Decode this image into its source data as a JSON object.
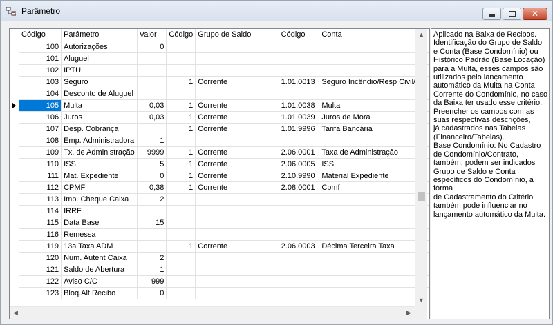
{
  "window": {
    "title": "Parâmetro",
    "close_glyph": "✕"
  },
  "icons": {
    "app": "database-icon",
    "minimize": "minimize-icon",
    "maximize": "maximize-icon",
    "close": "close-icon",
    "row_marker": "row-pointer-icon",
    "up": "arrow-up-icon",
    "down": "arrow-down-icon",
    "left": "arrow-left-icon",
    "right": "arrow-right-icon"
  },
  "grid": {
    "columns": [
      "Código",
      "Parâmetro",
      "Valor",
      "Código",
      "Grupo de Saldo",
      "Código",
      "Conta"
    ],
    "selected_code": "105",
    "vertical_scroll_position": 0.62,
    "rows": [
      [
        "100",
        "Autorizações",
        "0",
        "",
        "",
        "",
        ""
      ],
      [
        "101",
        "Aluguel",
        "",
        "",
        "",
        "",
        ""
      ],
      [
        "102",
        "IPTU",
        "",
        "",
        "",
        "",
        ""
      ],
      [
        "103",
        "Seguro",
        "",
        "1",
        "Corrente",
        "1.01.0013",
        "Seguro Incêndio/Resp Civil/Etc"
      ],
      [
        "104",
        "Desconto de Aluguel",
        "",
        "",
        "",
        "",
        ""
      ],
      [
        "105",
        "Multa",
        "0,03",
        "1",
        "Corrente",
        "1.01.0038",
        "Multa"
      ],
      [
        "106",
        "Juros",
        "0,03",
        "1",
        "Corrente",
        "1.01.0039",
        "Juros de Mora"
      ],
      [
        "107",
        "Desp. Cobrança",
        "",
        "1",
        "Corrente",
        "1.01.9996",
        "Tarifa Bancária"
      ],
      [
        "108",
        "Emp. Administradora",
        "1",
        "",
        "",
        "",
        ""
      ],
      [
        "109",
        "Tx. de Administração",
        "9999",
        "1",
        "Corrente",
        "2.06.0001",
        "Taxa de Administração"
      ],
      [
        "110",
        "ISS",
        "5",
        "1",
        "Corrente",
        "2.06.0005",
        "ISS"
      ],
      [
        "111",
        "Mat. Expediente",
        "0",
        "1",
        "Corrente",
        "2.10.9990",
        "Material Expediente"
      ],
      [
        "112",
        "CPMF",
        "0,38",
        "1",
        "Corrente",
        "2.08.0001",
        "Cpmf"
      ],
      [
        "113",
        "Imp. Cheque Caixa",
        "2",
        "",
        "",
        "",
        ""
      ],
      [
        "114",
        "IRRF",
        "",
        "",
        "",
        "",
        ""
      ],
      [
        "115",
        "Data Base",
        "15",
        "",
        "",
        "",
        ""
      ],
      [
        "116",
        "Remessa",
        "",
        "",
        "",
        "",
        ""
      ],
      [
        "119",
        "13a Taxa ADM",
        "",
        "1",
        "Corrente",
        "2.06.0003",
        "Décima Terceira Taxa"
      ],
      [
        "120",
        "Num. Autent Caixa",
        "2",
        "",
        "",
        "",
        ""
      ],
      [
        "121",
        "Saldo de Abertura",
        "1",
        "",
        "",
        "",
        ""
      ],
      [
        "122",
        "Aviso C/C",
        "999",
        "",
        "",
        "",
        ""
      ],
      [
        "123",
        "Bloq.Alt.Recibo",
        "0",
        "",
        "",
        "",
        ""
      ]
    ]
  },
  "help_lines": [
    "Aplicado na Baixa de Recibos.",
    "Identificação do Grupo de Saldo",
    "e Conta (Base Condomínio) ou",
    "Histórico Padrão (Base Locação)",
    "para a Multa, esses campos são",
    "utilizados pelo lançamento",
    "automático da Multa na Conta",
    "Corrente do Condomínio, no caso",
    "da Baixa ter usado esse critério.",
    "Preencher os campos com as",
    "suas respectivas descrições,",
    "já cadastrados nas Tabelas",
    "(Financeiro/Tabelas).",
    "Base Condomínio: No Cadastro",
    "de Condomínio/Contrato,",
    "também,  podem ser indicados",
    "Grupo de Saldo e Conta",
    "específicos do Condomínio, a",
    "forma",
    "de Cadastramento do Critério",
    "também pode influenciar no",
    "lançamento automático da Multa."
  ],
  "colors": {
    "selection": "#0078d7",
    "title_gradient_top": "#e9eef6",
    "close_button": "#c6452b"
  }
}
